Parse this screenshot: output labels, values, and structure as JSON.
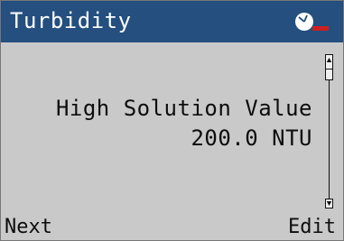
{
  "header": {
    "title": "Turbidity",
    "status_icon": "clock-with-red-flag-icon"
  },
  "main": {
    "label": "High Solution Value",
    "value": "200.0 NTU"
  },
  "softkeys": {
    "left": "Next",
    "right": "Edit"
  },
  "colors": {
    "titlebar": "#244f7f",
    "screen": "#c9c9c9",
    "alert": "#cc2020"
  }
}
